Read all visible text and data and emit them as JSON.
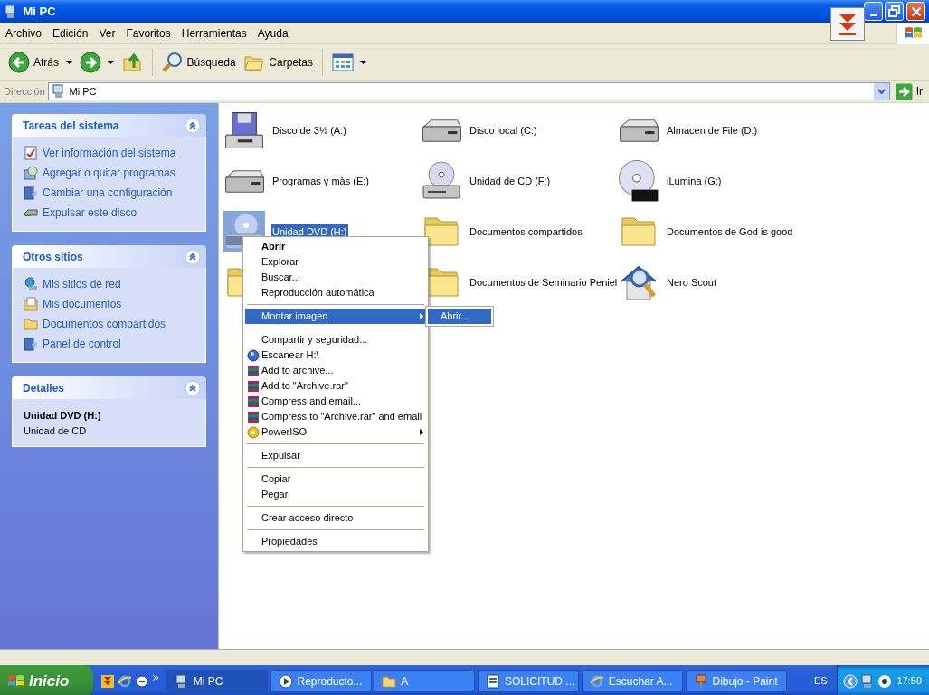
{
  "window": {
    "title": "Mi PC"
  },
  "menu_bar": [
    "Archivo",
    "Edición",
    "Ver",
    "Favoritos",
    "Herramientas",
    "Ayuda"
  ],
  "toolbar": [
    {
      "kind": "back",
      "label": "Atrás",
      "dropdown": true
    },
    {
      "kind": "forward",
      "dropdown": true
    },
    {
      "kind": "up",
      "dropdown": false
    },
    {
      "kind": "separator"
    },
    {
      "kind": "search",
      "label": "Búsqueda",
      "dropdown": false
    },
    {
      "kind": "folders",
      "label": "Carpetas",
      "dropdown": false
    },
    {
      "kind": "separator"
    },
    {
      "kind": "views",
      "dropdown": true
    }
  ],
  "address_bar": {
    "label": "Dirección",
    "value": "Mi PC",
    "go_label": "Ir"
  },
  "task_panels": [
    {
      "title": "Tareas del sistema",
      "expanded": true,
      "links": [
        "Ver información del sistema",
        "Agregar o quitar programas",
        "Cambiar una configuración",
        "Expulsar este disco"
      ]
    },
    {
      "title": "Otros sitios",
      "expanded": true,
      "links": [
        "Mis sitios de red",
        "Mis documentos",
        "Documentos compartidos",
        "Panel de control"
      ]
    },
    {
      "title": "Detalles",
      "expanded": true,
      "details": {
        "name": "Unidad DVD (H:)",
        "type": "Unidad de CD"
      }
    }
  ],
  "items": [
    {
      "kind": "floppy",
      "label": "Disco de 3½ (A:)",
      "selected": false
    },
    {
      "kind": "hdd",
      "label": "Disco local (C:)",
      "selected": false
    },
    {
      "kind": "hdd",
      "label": "Almacen de File (D:)",
      "selected": false
    },
    {
      "kind": "hdd",
      "label": "Programas y màs (E:)",
      "selected": false
    },
    {
      "kind": "cd",
      "label": "Unidad de CD (F:)",
      "selected": false
    },
    {
      "kind": "dvdr",
      "label": "iLumina (G:)",
      "selected": false
    },
    {
      "kind": "dvd",
      "label": "Unidad DVD (H:)",
      "selected": true
    },
    {
      "kind": "folder",
      "label": "Documentos compartidos",
      "selected": false
    },
    {
      "kind": "folder",
      "label": "Documentos de God is good",
      "selected": false
    },
    {
      "kind": "folder",
      "selected": false
    },
    {
      "kind": "folder",
      "label": "Documentos de Seminario Peniel",
      "selected": false
    },
    {
      "kind": "nero",
      "label": "Nero Scout",
      "selected": false
    }
  ],
  "context_menu": {
    "items": [
      {
        "kind": "plain",
        "label": "Abrir",
        "default": true,
        "selected": false,
        "submenu": false
      },
      {
        "kind": "plain",
        "label": "Explorar",
        "default": false,
        "selected": false,
        "submenu": false
      },
      {
        "kind": "plain",
        "label": "Buscar...",
        "default": false,
        "selected": false,
        "submenu": false
      },
      {
        "kind": "plain",
        "label": "Reproducción automática",
        "default": false,
        "selected": false,
        "submenu": false
      },
      {
        "kind": "separator"
      },
      {
        "kind": "plain",
        "label": "Montar imagen",
        "default": false,
        "selected": true,
        "submenu": true
      },
      {
        "kind": "separator"
      },
      {
        "kind": "plain",
        "label": "Compartir y seguridad...",
        "default": false,
        "selected": false,
        "submenu": false
      },
      {
        "kind": "scan",
        "label": "Escanear H:\\",
        "default": false,
        "selected": false,
        "submenu": false
      },
      {
        "kind": "archive",
        "label": "Add to archive...",
        "default": false,
        "selected": false,
        "submenu": false
      },
      {
        "kind": "archive",
        "label": "Add to \"Archive.rar\"",
        "default": false,
        "selected": false,
        "submenu": false
      },
      {
        "kind": "archive",
        "label": "Compress and email...",
        "default": false,
        "selected": false,
        "submenu": false
      },
      {
        "kind": "archive",
        "label": "Compress to \"Archive.rar\" and email",
        "default": false,
        "selected": false,
        "submenu": false
      },
      {
        "kind": "disc",
        "label": "PowerISO",
        "default": false,
        "selected": false,
        "submenu": true
      },
      {
        "kind": "separator"
      },
      {
        "kind": "plain",
        "label": "Expulsar",
        "default": false,
        "selected": false,
        "submenu": false
      },
      {
        "kind": "separator"
      },
      {
        "kind": "plain",
        "label": "Copiar",
        "default": false,
        "selected": false,
        "submenu": false
      },
      {
        "kind": "plain",
        "label": "Pegar",
        "default": false,
        "selected": false,
        "submenu": false
      },
      {
        "kind": "separator"
      },
      {
        "kind": "plain",
        "label": "Crear acceso directo",
        "default": false,
        "selected": false,
        "submenu": false
      },
      {
        "kind": "separator"
      },
      {
        "kind": "plain",
        "label": "Propiedades",
        "default": false,
        "selected": false,
        "submenu": false
      }
    ],
    "submenu": [
      {
        "label": "Abrir...",
        "selected": true
      }
    ]
  },
  "taskbar": {
    "start_label": "Inicio",
    "buttons": [
      {
        "label": "Mi PC",
        "selected": true
      },
      {
        "label": "Reproducto...",
        "selected": false
      },
      {
        "label": "A",
        "selected": false
      },
      {
        "label": "SOLICITUD ...",
        "selected": false
      },
      {
        "label": "Escuchar A...",
        "selected": false
      },
      {
        "label": "Dibujo - Paint",
        "selected": false
      }
    ],
    "language": "ES",
    "clock": "17:50"
  }
}
